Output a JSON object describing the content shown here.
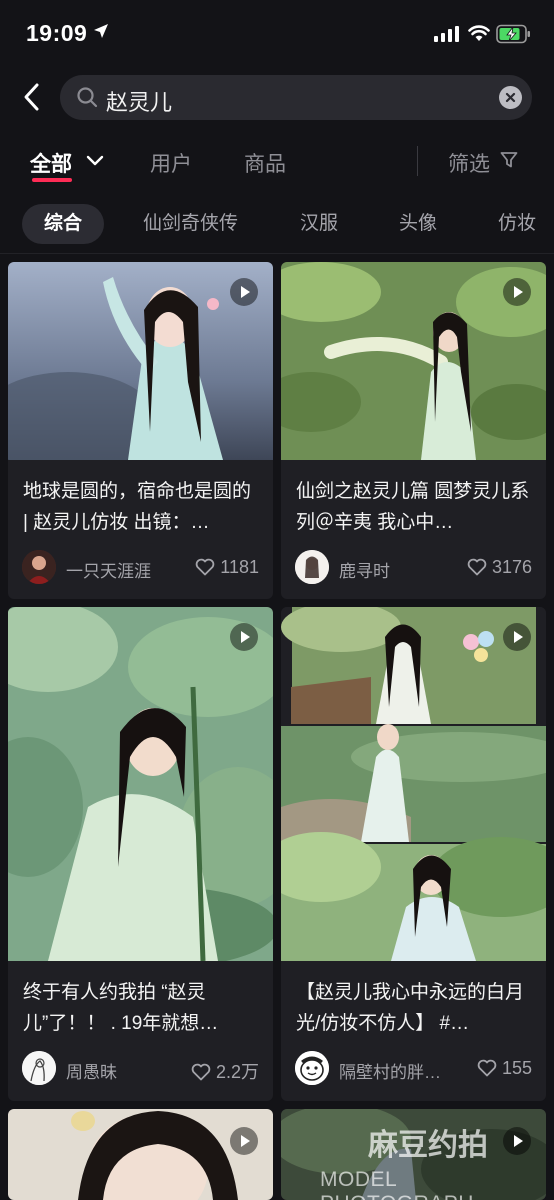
{
  "status_bar": {
    "time": "19:09",
    "icons": [
      "location-arrow-icon",
      "signal-icon",
      "wifi-icon",
      "battery-charging-icon"
    ]
  },
  "search": {
    "query": "赵灵儿",
    "icons": [
      "back-icon",
      "search-icon",
      "clear-icon"
    ]
  },
  "tabs": {
    "items": [
      "全部",
      "用户",
      "商品"
    ],
    "active": "全部",
    "filter_label": "筛选",
    "accent_color": "#fe2c55"
  },
  "chips": {
    "items": [
      "综合",
      "仙剑奇侠传",
      "汉服",
      "头像",
      "仿妆"
    ],
    "active": "综合"
  },
  "cards": [
    {
      "title": "地球是圆的，宿命也是圆的 | 赵灵儿仿妆 出镜：…",
      "author": "一只天涯涯",
      "likes": "1181",
      "type": "video"
    },
    {
      "title": "仙剑之赵灵儿篇 圆梦灵儿系列＠辛夷 我心中…",
      "author": "鹿寻时",
      "likes": "3176",
      "type": "video"
    },
    {
      "title": "终于有人约我拍 “赵灵儿”了！！ . 19年就想…",
      "author": "周愚昧",
      "likes": "2.2万",
      "type": "video"
    },
    {
      "title": "【赵灵儿我心中永远的白月光/仿妆不仿人】 #…",
      "author": "隔壁村的胖…",
      "likes": "155",
      "type": "video"
    }
  ],
  "watermark": {
    "line1": "麻豆约拍",
    "line2": "MODEL PHOTOGRAPH"
  }
}
